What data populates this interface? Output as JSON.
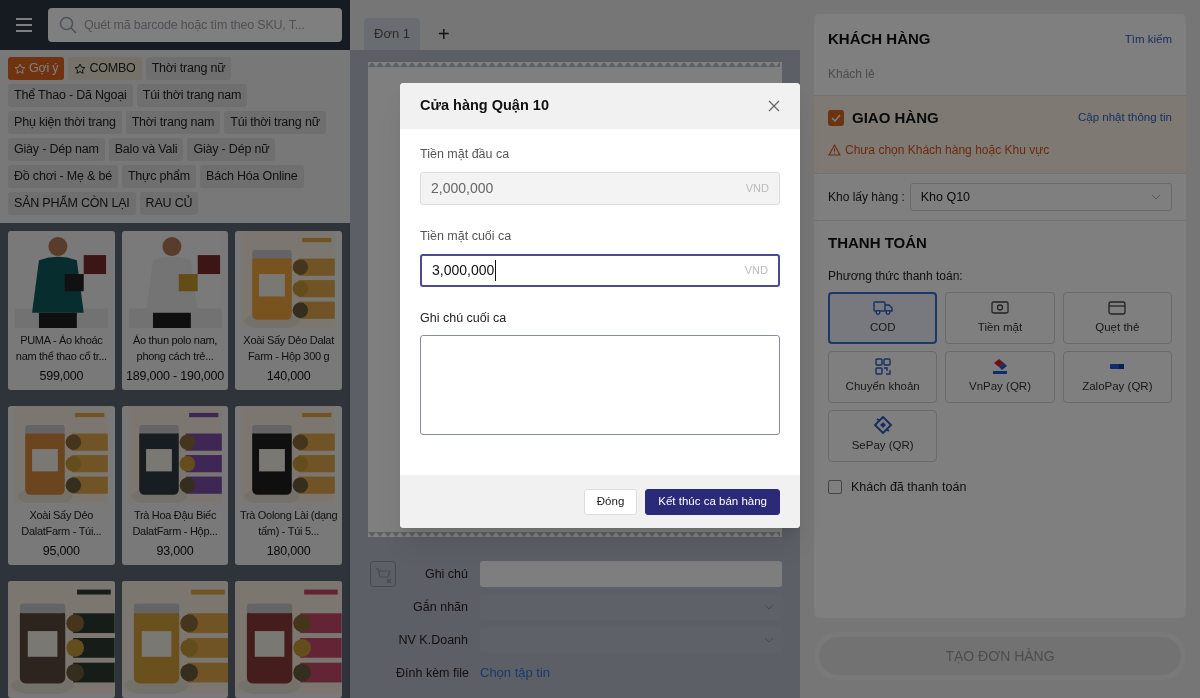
{
  "left_panel": {
    "search": {
      "placeholder": "Quét mã barcode hoặc tìm theo SKU, T..."
    },
    "categories": [
      {
        "label": "Gợi ý",
        "kind": "featured",
        "selected": true
      },
      {
        "label": "COMBO",
        "kind": "featured",
        "selected": false
      },
      {
        "label": "Thời trang nữ",
        "kind": "category",
        "selected": false
      },
      {
        "label": "Thể Thao - Dã Ngoại",
        "kind": "category",
        "selected": false
      },
      {
        "label": "Túi thời trang nam",
        "kind": "category",
        "selected": false
      },
      {
        "label": "Phụ kiện thời trang",
        "kind": "category",
        "selected": false
      },
      {
        "label": "Thời trang nam",
        "kind": "category",
        "selected": false
      },
      {
        "label": "Túi thời trang nữ",
        "kind": "category",
        "selected": false
      },
      {
        "label": "Giày - Dép nam",
        "kind": "category",
        "selected": false
      },
      {
        "label": "Balo và Vali",
        "kind": "category",
        "selected": false
      },
      {
        "label": "Giày - Dép nữ",
        "kind": "category",
        "selected": false
      },
      {
        "label": "Đồ chơi - Mẹ & bé",
        "kind": "category",
        "selected": false
      },
      {
        "label": "Thực phẩm",
        "kind": "category",
        "selected": false
      },
      {
        "label": "Bách Hóa Online",
        "kind": "category",
        "selected": false
      },
      {
        "label": "SẢN PHẨM CÒN LẠI",
        "kind": "category",
        "selected": false
      },
      {
        "label": "RAU CỦ",
        "kind": "category",
        "selected": false
      }
    ],
    "products": [
      {
        "image": {
          "kind": "picture"
        },
        "name": "PUMA - Áo khoác nam thể thao cổ tr...",
        "price": "599,000"
      },
      {
        "image": {
          "kind": "picture"
        },
        "name": "Áo thun polo nam, phong cách trẻ...",
        "price": "189,000 - 190,000"
      },
      {
        "image": {
          "kind": "picture"
        },
        "name": "Xoài Sấy Dẻo Dalat Farm - Hộp 300 g",
        "price": "140,000"
      },
      {
        "image": {
          "kind": "picture"
        },
        "name": "Xoài Sấy Dẻo DalatFarm - Túi...",
        "price": "95,000"
      },
      {
        "image": {
          "kind": "picture"
        },
        "name": "Trà Hoa Đậu Biếc DalatFarm - Hộp...",
        "price": "93,000"
      },
      {
        "image": {
          "kind": "picture"
        },
        "name": "Trà Oolong Lài (dạng tấm) - Túi 5...",
        "price": "180,000"
      },
      {
        "image": {
          "kind": "picture"
        }
      },
      {
        "image": {
          "kind": "picture"
        }
      },
      {
        "image": {
          "kind": "picture"
        }
      }
    ]
  },
  "order": {
    "tabs": [
      {
        "label": "Đơn 1",
        "selected": true
      }
    ],
    "add_tab": "+",
    "fields": [
      {
        "label": "Ghi chú",
        "kind": "input"
      },
      {
        "label": "Gắn nhãn",
        "kind": "select"
      },
      {
        "label": "NV K.Doanh",
        "kind": "select"
      },
      {
        "label": "Đính kèm file",
        "kind": "file",
        "link": "Chọn tập tin"
      }
    ]
  },
  "right_panel": {
    "customer": {
      "title": "KHÁCH HÀNG",
      "search_link": "Tìm kiếm",
      "value": "Khách lẻ"
    },
    "delivery": {
      "checked": true,
      "title": "GIAO HÀNG",
      "update_link": "Cập nhật thông tin",
      "warning": "Chưa chọn Khách hàng hoặc Khu vực"
    },
    "warehouse": {
      "label": "Kho lấy hàng :",
      "value": "Kho Q10"
    },
    "payment": {
      "title": "THANH TOÁN",
      "label": "Phương thức thanh toán:",
      "methods": [
        {
          "label": "COD",
          "kind": "truck",
          "selected": true
        },
        {
          "label": "Tiền mặt",
          "kind": "cash",
          "selected": false
        },
        {
          "label": "Quẹt thẻ",
          "kind": "card",
          "selected": false
        },
        {
          "label": "Chuyển khoản",
          "kind": "qr",
          "selected": false
        },
        {
          "label": "VnPay (QR)",
          "kind": "vnpay",
          "selected": false
        },
        {
          "label": "ZaloPay (QR)",
          "kind": "zalopay",
          "selected": false
        },
        {
          "label": "SePay (QR)",
          "kind": "sepay",
          "selected": false
        }
      ],
      "paid": {
        "label": "Khách đã thanh toán",
        "checked": false
      }
    },
    "create_button": {
      "label": "TẠO ĐƠN HÀNG",
      "disabled": true
    }
  },
  "modal": {
    "title": "Cửa hàng Quận 10",
    "fields": [
      {
        "label": "Tiền mặt đầu ca",
        "value": "2,000,000",
        "suffix": "VND",
        "disabled": true,
        "focused": false
      },
      {
        "label": "Tiền mặt cuối ca",
        "value": "3,000,000",
        "suffix": "VND",
        "disabled": false,
        "focused": true
      }
    ],
    "note": {
      "label": "Ghi chú cuối ca"
    },
    "buttons": [
      {
        "label": "Đóng",
        "kind": "secondary"
      },
      {
        "label": "Kết thúc ca bán hàng",
        "kind": "primary"
      }
    ]
  }
}
